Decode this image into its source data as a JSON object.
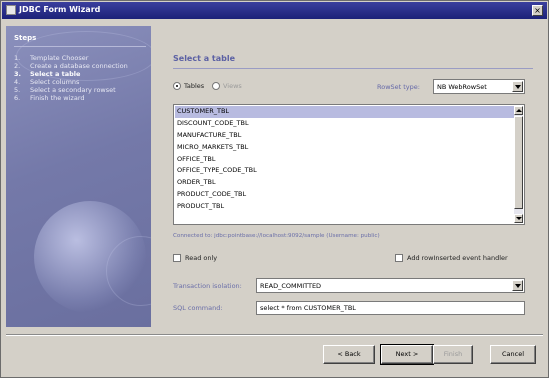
{
  "window": {
    "title": "JDBC Form Wizard",
    "close_label": "×"
  },
  "sidebar": {
    "title": "Steps",
    "steps": [
      {
        "num": "1.",
        "label": "Template Chooser"
      },
      {
        "num": "2.",
        "label": "Create a database connection"
      },
      {
        "num": "3.",
        "label": "Select a table"
      },
      {
        "num": "4.",
        "label": "Select columns"
      },
      {
        "num": "5.",
        "label": "Select a secondary rowset"
      },
      {
        "num": "6.",
        "label": "Finish the wizard"
      }
    ],
    "current_step": 3
  },
  "main": {
    "heading": "Select a table",
    "radio_tables": "Tables",
    "radio_views": "Views",
    "rowset_type_label": "RowSet type:",
    "rowset_type_value": "NB WebRowSet",
    "tables": [
      "CUSTOMER_TBL",
      "DISCOUNT_CODE_TBL",
      "MANUFACTURE_TBL",
      "MICRO_MARKETS_TBL",
      "OFFICE_TBL",
      "OFFICE_TYPE_CODE_TBL",
      "ORDER_TBL",
      "PRODUCT_CODE_TBL",
      "PRODUCT_TBL"
    ],
    "connected_to": "Connected to: jdbc:pointbase://localhost:9092/sample (Username: public)",
    "read_only_label": "Read only",
    "add_handler_label": "Add rowInserted event handler",
    "transaction_label": "Transaction isolation:",
    "transaction_value": "READ_COMMITTED",
    "sql_label": "SQL command:",
    "sql_value": "select * from CUSTOMER_TBL"
  },
  "buttons": {
    "back": "< Back",
    "next": "Next >",
    "finish": "Finish",
    "cancel": "Cancel"
  },
  "colors": {
    "title_bar": "#2a2f8c",
    "sidebar": "#7a7fae",
    "heading": "#5c61a4",
    "selection": "#b8bbe0"
  }
}
